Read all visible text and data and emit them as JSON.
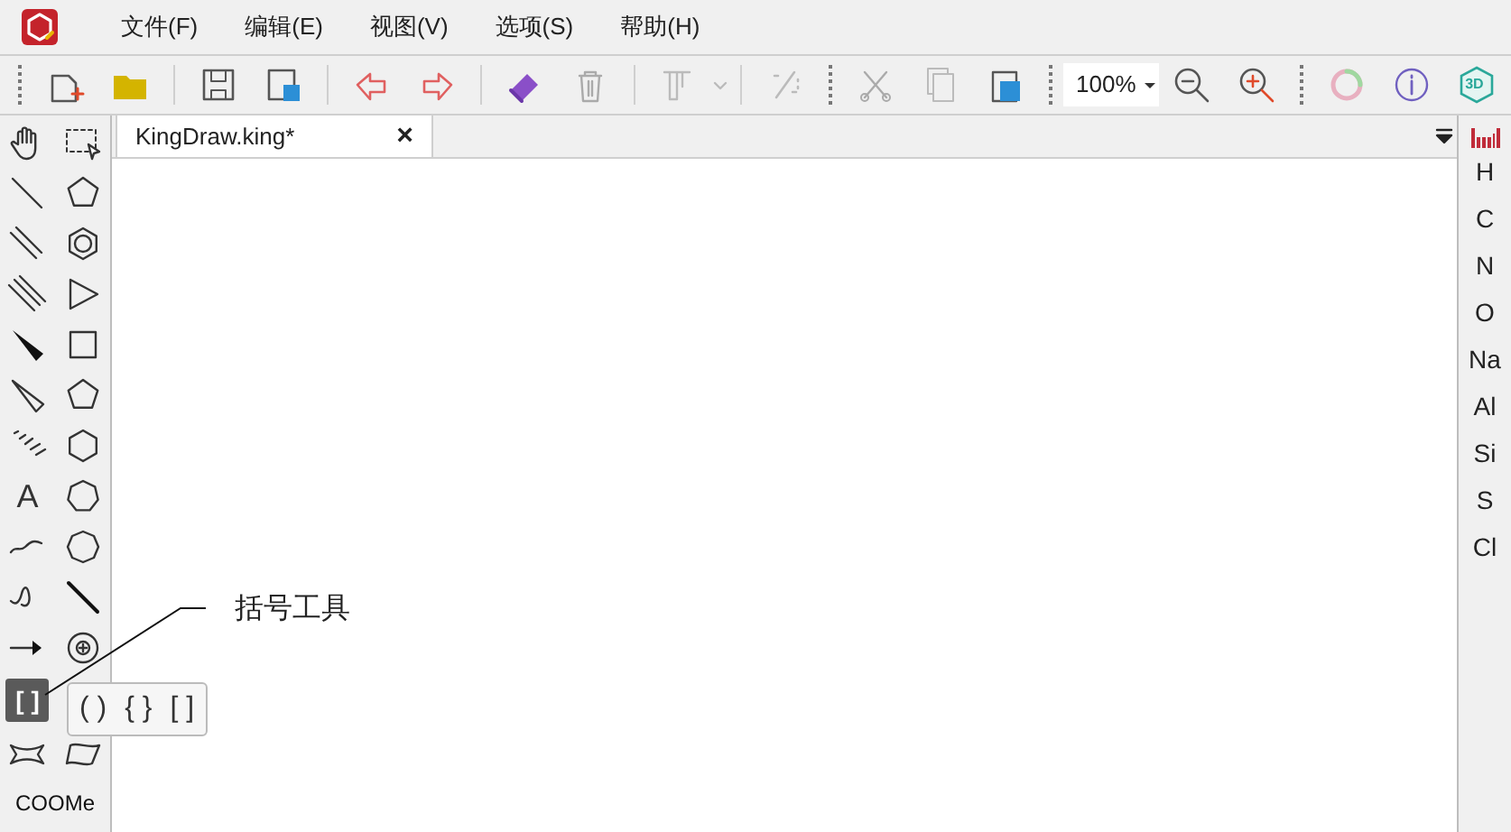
{
  "menu": [
    "文件(F)",
    "编辑(E)",
    "视图(V)",
    "选项(S)",
    "帮助(H)"
  ],
  "toolbar": {
    "zoom_value": "100%",
    "view_3d_label": "3D"
  },
  "tabs": [
    {
      "label": "KingDraw.king*",
      "selected": true,
      "close": "×"
    }
  ],
  "left_tools": {
    "text_tool": "A",
    "bracket_tool": {
      "label": "[ ]",
      "selected": true
    },
    "group_tool": "COOMe"
  },
  "bracket_popup": [
    "( )",
    "{ }",
    "[ ]"
  ],
  "callout": "括号工具",
  "elements": [
    "H",
    "C",
    "N",
    "O",
    "Na",
    "Al",
    "Si",
    "S",
    "Cl"
  ]
}
